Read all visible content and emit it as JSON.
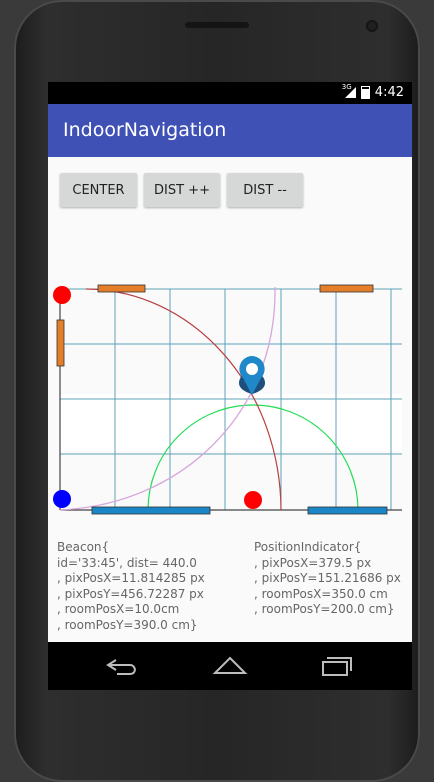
{
  "status_bar": {
    "network_type": "3G",
    "time": "4:42"
  },
  "app_bar": {
    "title": "IndoorNavigation",
    "color": "#3f51b5"
  },
  "buttons": {
    "center": "CENTER",
    "dist_plus": "DIST ++",
    "dist_minus": "DIST --"
  },
  "beacon_info": {
    "line1": "Beacon{",
    "line2": "id='33:45', dist= 440.0",
    "line3": ", pixPosX=11.814285 px",
    "line4": ", pixPosY=456.72287 px",
    "line5": ", roomPosX=10.0cm",
    "line6": ", roomPosY=390.0 cm}"
  },
  "position_info": {
    "line1": "PositionIndicator{",
    "line2": "",
    "line3": ", pixPosX=379.5 px",
    "line4": ", pixPosY=151.21686 px",
    "line5": ", roomPosX=350.0 cm",
    "line6": ", roomPosY=200.0 cm}"
  },
  "nav_icons": [
    "back-icon",
    "home-icon",
    "recents-icon"
  ],
  "colors": {
    "beacon_red": "#ff0000",
    "beacon_blue": "#0000ff",
    "wall_orange": "#e57e28",
    "wall_blue": "#1a86c8",
    "grid": "#5fa3b8",
    "location_pin": "#1e88c8"
  }
}
